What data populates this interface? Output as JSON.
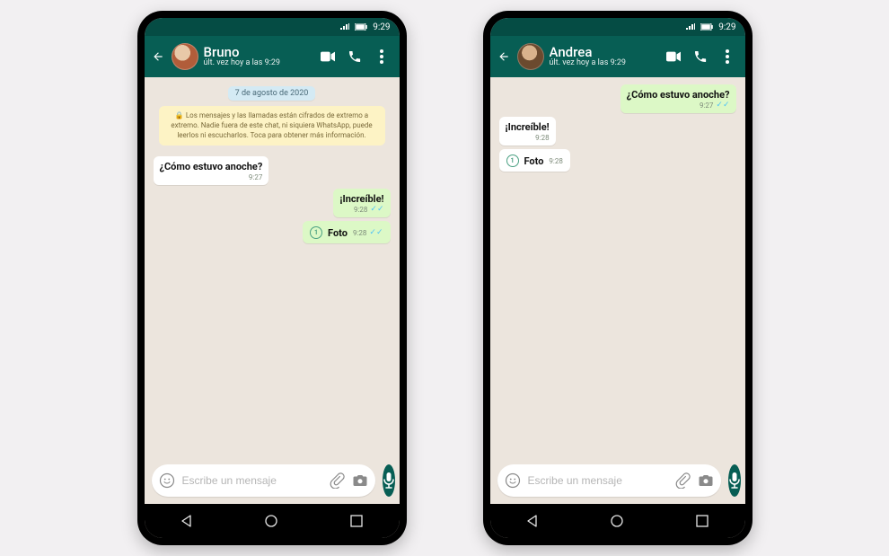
{
  "status_time": "9:29",
  "phones": [
    {
      "contact_name": "Bruno",
      "last_seen": "últ. vez hoy a las 9:29",
      "date_chip": "7 de agosto de 2020",
      "encryption_notice": "Los mensajes y las llamadas están cifrados de extremo a extremo. Nadie fuera de este chat, ni siquiera WhatsApp, puede leerlos ni escucharlos. Toca para obtener más información.",
      "messages": [
        {
          "dir": "in",
          "type": "text",
          "text": "¿Cómo estuvo anoche?",
          "time": "9:27",
          "read": false
        },
        {
          "dir": "out",
          "type": "text",
          "text": "¡Increíble!",
          "time": "9:28",
          "read": true
        },
        {
          "dir": "out",
          "type": "media",
          "text": "Foto",
          "time": "9:28",
          "read": true
        }
      ],
      "input_placeholder": "Escribe un mensaje"
    },
    {
      "contact_name": "Andrea",
      "last_seen": "últ. vez hoy a las 9:29",
      "date_chip": null,
      "encryption_notice": null,
      "messages": [
        {
          "dir": "out",
          "type": "text",
          "text": "¿Cómo estuvo anoche?",
          "time": "9:27",
          "read": true
        },
        {
          "dir": "in",
          "type": "text",
          "text": "¡Increíble!",
          "time": "9:28",
          "read": false
        },
        {
          "dir": "in",
          "type": "media",
          "text": "Foto",
          "time": "9:28",
          "read": false
        }
      ],
      "input_placeholder": "Escribe un mensaje"
    }
  ]
}
